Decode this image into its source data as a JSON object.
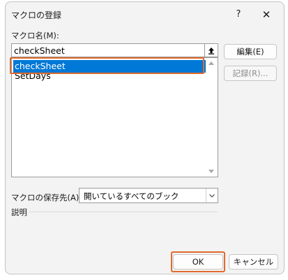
{
  "dialog": {
    "title": "マクロの登録",
    "help_label": "?",
    "close_label": "✕"
  },
  "macro_name": {
    "label": "マクロ名(M):",
    "value": "checkSheet"
  },
  "macro_list": {
    "items": [
      {
        "label": "checkSheet",
        "selected": true
      },
      {
        "label": "SetDays",
        "selected": false
      }
    ]
  },
  "buttons": {
    "edit": "編集(E)",
    "record": "記録(R)...",
    "ok": "OK",
    "cancel": "キャンセル"
  },
  "macro_location": {
    "label": "マクロの保存先(A):",
    "value": "開いているすべてのブック"
  },
  "description": {
    "label": "説明"
  },
  "colors": {
    "selection": "#0078d7",
    "highlight_outline": "#e06a2c"
  }
}
